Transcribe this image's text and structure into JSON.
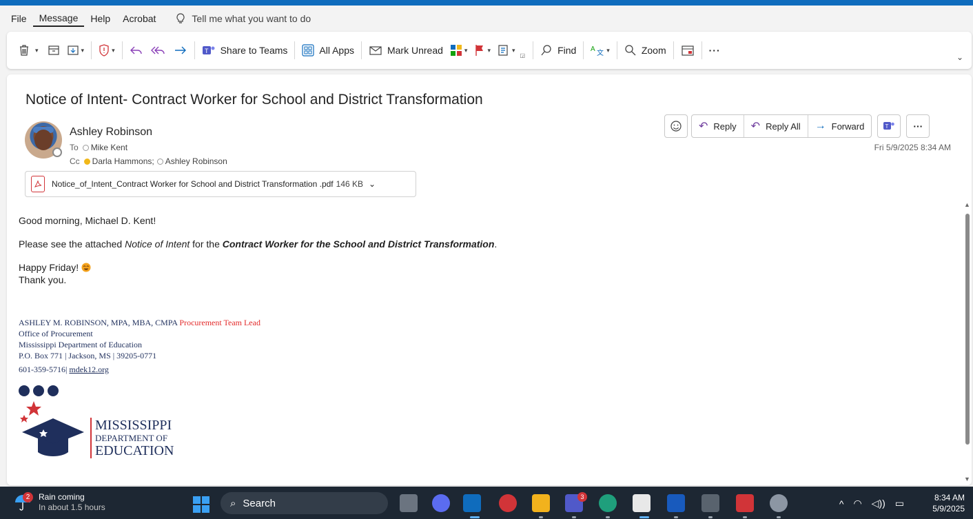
{
  "menubar": {
    "items": [
      "File",
      "Message",
      "Help",
      "Acrobat"
    ],
    "active": "Message",
    "tell_me": "Tell me what you want to do"
  },
  "ribbon": {
    "share_to_teams": "Share to Teams",
    "all_apps": "All Apps",
    "mark_unread": "Mark Unread",
    "find": "Find",
    "zoom": "Zoom",
    "more": "···"
  },
  "message": {
    "subject": "Notice of Intent- Contract Worker for School and District Transformation",
    "sender": "Ashley Robinson",
    "to_label": "To",
    "to": "Mike Kent",
    "cc_label": "Cc",
    "cc": [
      "Darla Hammons;",
      "Ashley Robinson"
    ],
    "datetime": "Fri 5/9/2025 8:34 AM",
    "actions": {
      "reply": "Reply",
      "reply_all": "Reply All",
      "forward": "Forward"
    },
    "attachment": {
      "name": "Notice_of_Intent_Contract Worker for School and District Transformation .pdf",
      "size": "146 KB"
    },
    "body": {
      "greeting": "Good morning, Michael D. Kent!",
      "line1_pre": "Please see the attached ",
      "line1_italic": "Notice of Intent",
      "line1_mid": " for the ",
      "line1_bold": "Contract Worker for the School and District Transformation",
      "line1_end": ".",
      "happy": "Happy Friday! ",
      "thanks": "Thank you."
    },
    "signature": {
      "name": "ASHLEY M. ROBINSON, MPA, MBA, CMPA ",
      "title": "Procurement Team Lead",
      "office": "Office of Procurement",
      "dept": "Mississippi Department of Education",
      "address": "P.O. Box 771 | Jackson, MS | 39205-0771",
      "phone": "601-359-5716| ",
      "website": "mdek12.org"
    },
    "logo": {
      "line1": "MISSISSIPPI",
      "line2": "DEPARTMENT OF",
      "line3": "EDUCATION"
    }
  },
  "taskbar": {
    "weather_title": "Rain coming",
    "weather_sub": "In about 1.5 hours",
    "weather_badge": "2",
    "search": "Search",
    "teams_badge": "3",
    "time": "8:34 AM",
    "date": "5/9/2025"
  },
  "colors": {
    "accent": "#0f6cbd",
    "taskbar": "#1d2733",
    "sig_red": "#e32b2b",
    "sig_navy": "#1f2f5c"
  }
}
